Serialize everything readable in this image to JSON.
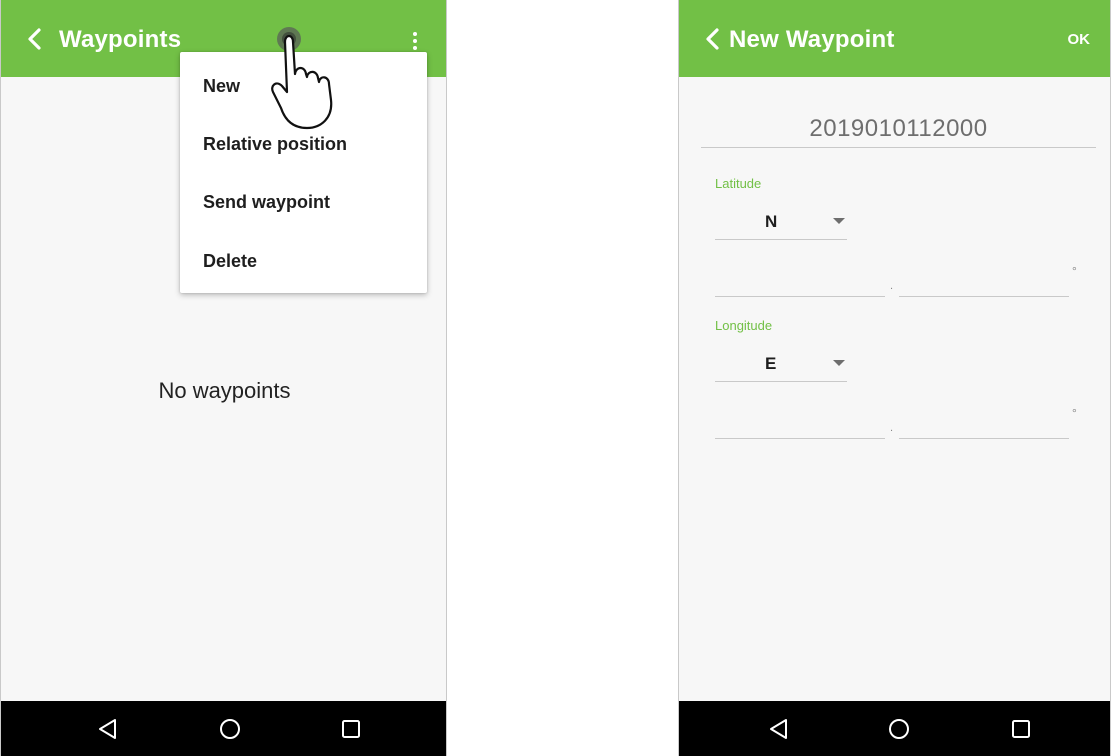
{
  "left_screen": {
    "title": "Waypoints",
    "menu": {
      "items": [
        "New",
        "Relative position",
        "Send waypoint",
        "Delete"
      ]
    },
    "empty_message": "No waypoints",
    "icons": [
      "back-icon",
      "overflow-menu-icon",
      "pointing-hand-icon"
    ]
  },
  "right_screen": {
    "title": "New Waypoint",
    "ok_label": "OK",
    "name_value": "2019010112000",
    "latitude": {
      "label": "Latitude",
      "hemisphere": "N",
      "separator": ".",
      "unit": "°"
    },
    "longitude": {
      "label": "Longitude",
      "hemisphere": "E",
      "separator": ".",
      "unit": "°"
    }
  },
  "navbar_icons": [
    "back-triangle-icon",
    "home-circle-icon",
    "recents-square-icon"
  ],
  "colors": {
    "accent": "#72c046",
    "navbar": "#000000",
    "background": "#f7f7f7"
  }
}
